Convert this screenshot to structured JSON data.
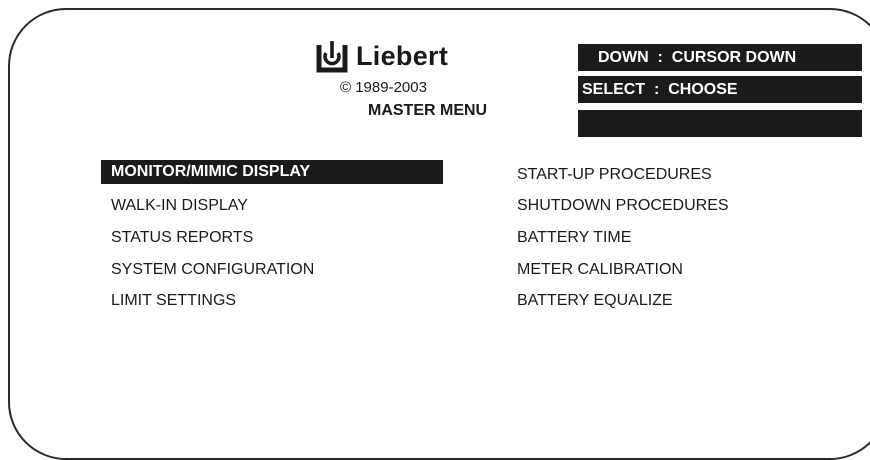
{
  "header": {
    "brand": "Liebert",
    "logo_icon": "liebert-logo-icon",
    "copyright": "© 1989-2003",
    "title": "MASTER MENU"
  },
  "hints": {
    "line1": "DOWN  :  CURSOR DOWN",
    "line2": "SELECT  :  CHOOSE",
    "line3": ""
  },
  "menu": {
    "left": [
      {
        "label": "MONITOR/MIMIC DISPLAY",
        "selected": true
      },
      {
        "label": "WALK-IN DISPLAY"
      },
      {
        "label": "STATUS REPORTS"
      },
      {
        "label": "SYSTEM CONFIGURATION"
      },
      {
        "label": "LIMIT SETTINGS"
      }
    ],
    "right": [
      {
        "label": "START-UP PROCEDURES"
      },
      {
        "label": "SHUTDOWN PROCEDURES"
      },
      {
        "label": "BATTERY TIME"
      },
      {
        "label": "METER CALIBRATION"
      },
      {
        "label": "BATTERY EQUALIZE"
      }
    ]
  }
}
